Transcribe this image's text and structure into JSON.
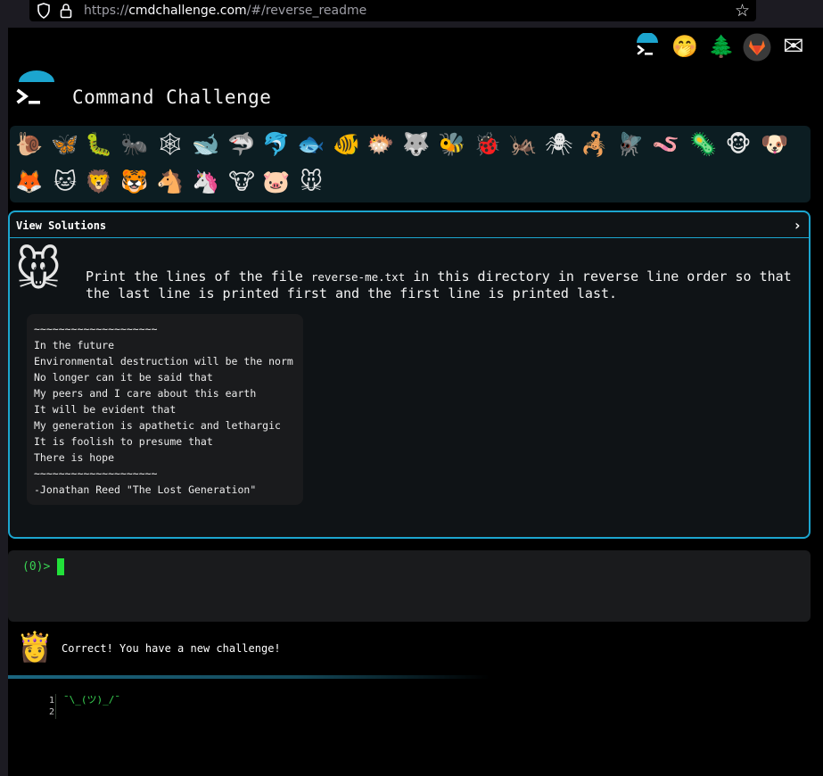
{
  "browser": {
    "url_prefix": "https://",
    "url_host": "cmdchallenge.com",
    "url_path": "/#/reverse_readme"
  },
  "header": {
    "title": "Command Challenge",
    "top_icons": [
      {
        "name": "cmd-logo-icon",
        "glyph": ""
      },
      {
        "name": "shush-face-icon",
        "glyph": "🤭"
      },
      {
        "name": "tree-icon",
        "glyph": "🌲"
      },
      {
        "name": "gitlab-icon",
        "glyph": ""
      },
      {
        "name": "envelope-icon",
        "glyph": "✉"
      }
    ]
  },
  "animals": [
    {
      "name": "snail-icon",
      "glyph": "🐌"
    },
    {
      "name": "butterfly-icon",
      "glyph": "🦋"
    },
    {
      "name": "caterpillar-icon",
      "glyph": "🐛"
    },
    {
      "name": "ant-icon",
      "glyph": "🐜"
    },
    {
      "name": "web-icon",
      "glyph": "🕸"
    },
    {
      "name": "whale-icon",
      "glyph": "🐋"
    },
    {
      "name": "shark-icon",
      "glyph": "🦈"
    },
    {
      "name": "dolphin-icon",
      "glyph": "🐬"
    },
    {
      "name": "fish-icon",
      "glyph": "🐟"
    },
    {
      "name": "tropical-fish-icon",
      "glyph": "🐠"
    },
    {
      "name": "blowfish-icon",
      "glyph": "🐡"
    },
    {
      "name": "wolf-icon",
      "glyph": "🐺"
    },
    {
      "name": "bee-icon",
      "glyph": "🐝"
    },
    {
      "name": "ladybug-icon",
      "glyph": "🐞"
    },
    {
      "name": "cricket-icon",
      "glyph": "🦗"
    },
    {
      "name": "spider-icon",
      "glyph": "🕷"
    },
    {
      "name": "scorpion-icon",
      "glyph": "🦂"
    },
    {
      "name": "fly-icon",
      "glyph": "🪰"
    },
    {
      "name": "worm-icon",
      "glyph": "🪱"
    },
    {
      "name": "microbe-icon",
      "glyph": "🦠"
    },
    {
      "name": "monkey-icon",
      "glyph": "🐵"
    },
    {
      "name": "dog-icon",
      "glyph": "🐶"
    },
    {
      "name": "fox-icon",
      "glyph": "🦊"
    },
    {
      "name": "cat-icon",
      "glyph": "🐱"
    },
    {
      "name": "lion-icon",
      "glyph": "🦁"
    },
    {
      "name": "tiger-icon",
      "glyph": "🐯"
    },
    {
      "name": "horse-icon",
      "glyph": "🐴"
    },
    {
      "name": "unicorn-icon",
      "glyph": "🦄"
    },
    {
      "name": "cow-icon",
      "glyph": "🐮"
    },
    {
      "name": "pig-icon",
      "glyph": "🐷"
    },
    {
      "name": "mouse-icon",
      "glyph": "🐭"
    }
  ],
  "challenge": {
    "view_solutions": "View Solutions",
    "description_before": "Print the lines of the file ",
    "filename": "reverse-me.txt",
    "description_after": " in this directory in reverse line order so that the last line is printed first and the first line is printed last.",
    "poem": [
      "~~~~~~~~~~~~~~~~~~~~",
      "In the future",
      "Environmental destruction will be the norm",
      "No longer can it be said that",
      "My peers and I care about this earth",
      "It will be evident that",
      "My generation is apathetic and lethargic",
      "It is foolish to presume that",
      "There is hope",
      "~~~~~~~~~~~~~~~~~~~~",
      "-Jonathan Reed \"The Lost Generation\""
    ]
  },
  "terminal": {
    "prompt": "(0)>"
  },
  "result": {
    "message": "Correct! You have a new challenge!"
  },
  "editor": {
    "line_numbers": [
      "1",
      "2"
    ],
    "code": "¯\\_(ツ)_/¯"
  },
  "colors": {
    "accent": "#1ca5cf",
    "prompt_green": "#39d353",
    "page_bg": "#000000"
  }
}
